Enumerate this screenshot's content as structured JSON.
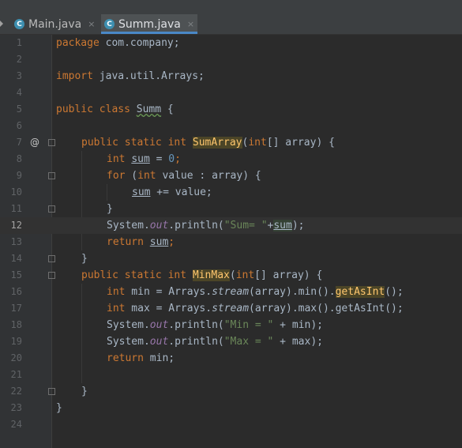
{
  "tabs": [
    {
      "label": "Main.java",
      "icon": "C",
      "active": false
    },
    {
      "label": "Summ.java",
      "icon": "C",
      "active": true
    }
  ],
  "tab_close_glyph": "×",
  "gutter_marker": "@",
  "lines": [
    {
      "n": "1"
    },
    {
      "n": "2"
    },
    {
      "n": "3"
    },
    {
      "n": "4"
    },
    {
      "n": "5"
    },
    {
      "n": "6"
    },
    {
      "n": "7"
    },
    {
      "n": "8"
    },
    {
      "n": "9"
    },
    {
      "n": "10"
    },
    {
      "n": "11"
    },
    {
      "n": "12"
    },
    {
      "n": "13"
    },
    {
      "n": "14"
    },
    {
      "n": "15"
    },
    {
      "n": "16"
    },
    {
      "n": "17"
    },
    {
      "n": "18"
    },
    {
      "n": "19"
    },
    {
      "n": "20"
    },
    {
      "n": "21"
    },
    {
      "n": "22"
    },
    {
      "n": "23"
    },
    {
      "n": "24"
    }
  ],
  "code": {
    "l1": [
      "package",
      " com.company;"
    ],
    "l3": [
      "import",
      " java.util.Arrays;"
    ],
    "l5": [
      "public class",
      " ",
      "Summ",
      " {"
    ],
    "l7": [
      "public static int",
      " ",
      "SumArray",
      "(",
      "int",
      "[] array) {"
    ],
    "l8": [
      "int",
      " ",
      "sum",
      " = ",
      "0",
      ";"
    ],
    "l9": [
      "for",
      " (",
      "int",
      " value : array) {"
    ],
    "l10": [
      "sum",
      " += value;"
    ],
    "l11": [
      "}"
    ],
    "l12": [
      "System.",
      "out",
      ".println(",
      "\"Sum= \"",
      "+",
      "sum",
      ");"
    ],
    "l13": [
      "return",
      " ",
      "sum",
      ";"
    ],
    "l14": [
      "}"
    ],
    "l15": [
      "public static int",
      " ",
      "MinMax",
      "(",
      "int",
      "[] array) {"
    ],
    "l16": [
      "int",
      " min = Arrays.",
      "stream",
      "(array).min().",
      "getAsInt",
      "();"
    ],
    "l17": [
      "int",
      " max = Arrays.",
      "stream",
      "(array).max().getAsInt();"
    ],
    "l18": [
      "System.",
      "out",
      ".println(",
      "\"Min = \"",
      " + min);"
    ],
    "l19": [
      "System.",
      "out",
      ".println(",
      "\"Max = \"",
      " + max);"
    ],
    "l20": [
      "return",
      " min;"
    ],
    "l22": [
      "}"
    ],
    "l23": [
      "}"
    ]
  },
  "current_line": "12",
  "colors": {
    "background": "#2b2b2b",
    "keyword": "#cc7832",
    "string": "#6a8759",
    "number": "#6897bb",
    "field": "#9876aa",
    "text": "#a9b7c6",
    "active_tab_underline": "#4a88c7"
  }
}
